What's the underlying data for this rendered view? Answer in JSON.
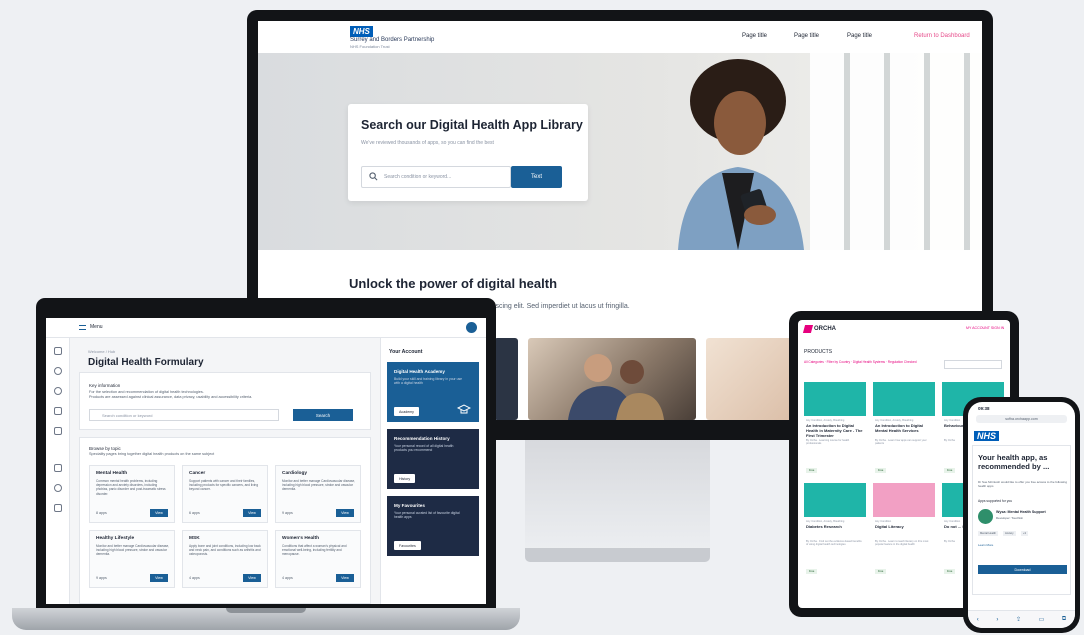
{
  "colors": {
    "nhs_blue": "#005eb8",
    "primary_button": "#1a5f96",
    "dark_card": "#1e2b45",
    "orcha_pink": "#e6007e",
    "nav_accent": "#e64a8a"
  },
  "desktop": {
    "logo_badge": "NHS",
    "org_name": "Surrey and Borders Partnership",
    "org_sub": "NHS Foundation Trust",
    "nav": [
      "Page title",
      "Page title",
      "Page title"
    ],
    "return_link": "Return to Dashboard",
    "hero": {
      "title": "Search our Digital Health App Library",
      "subtitle": "We've reviewed thousands of apps, so you can find the best",
      "search_placeholder": "Search condition or keyword...",
      "button": "Text"
    },
    "section_title": "Unlock the power of digital health",
    "section_text": "piscing elit. Sed imperdiet ut lacus ut fringilla."
  },
  "laptop": {
    "menu_label": "Menu",
    "breadcrumb": "Welcome / Hub",
    "page_title": "Digital Health Formulary",
    "info_heading": "Key information",
    "info_text_1": "For the selection and recommendation of digital health technologies.",
    "info_text_2": "Products are assessed against clinical assurance, data privacy, usability and accessibility criteria.",
    "search_placeholder": "Search condition or keyword",
    "search_button": "Search",
    "browse_heading": "Browse by topic",
    "browse_text": "Speciality pages bring together digital health products on the same subject",
    "categories": [
      {
        "title": "Mental Health",
        "desc": "Common mental health problems, including depression and anxiety disorders, including phobias, panic disorder and post-traumatic stress disorder.",
        "count": "8 apps",
        "button": "View"
      },
      {
        "title": "Cancer",
        "desc": "Support patients with cancer and their families, including products for specific cancers, and living beyond cancer.",
        "count": "6 apps",
        "button": "View"
      },
      {
        "title": "Cardiology",
        "desc": "Monitor and better manage Cardiovascular disease, including high blood pressure, stroke and vascular dementia.",
        "count": "9 apps",
        "button": "View"
      },
      {
        "title": "Healthy Lifestyle",
        "desc": "Monitor and better manage Cardiovascular disease, including high blood pressure, stroke and vascular dementia.",
        "count": "9 apps",
        "button": "View"
      },
      {
        "title": "MSK",
        "desc": "Apply bone and joint conditions, including low back and neck pain, and conditions such as arthritis and osteoporosis.",
        "count": "4 apps",
        "button": "View"
      },
      {
        "title": "Women's Health",
        "desc": "Conditions that affect a woman's physical and emotional well-being, including fertility and menopause.",
        "count": "4 apps",
        "button": "View"
      }
    ],
    "account": {
      "heading": "Your Account",
      "cards": [
        {
          "title": "Digital Health Academy",
          "desc": "Build your skill and training library in your use with a digital health",
          "button": "Academy"
        },
        {
          "title": "Recommendation History",
          "desc": "Your personal record of all digital health products you recommend",
          "button": "History"
        },
        {
          "title": "My Favourites",
          "desc": "Your personal curated list of favourite digital health apps",
          "button": "Favourites"
        }
      ]
    }
  },
  "tablet": {
    "logo": "ORCHA",
    "top_links": "MY ACCOUNT   SIGN IN",
    "products_label": "PRODUCTS",
    "filters": "All Categories · Filter by Country · Digital Health Systems · Regulation Checked",
    "cards": [
      {
        "category": "Any Condition, Anxiety, Breathing",
        "title": "An Introduction to Digital Health in Maternity Care - The First Trimester",
        "meta": "By Orcha · Learning course for health professionals",
        "tag": "Free",
        "img": "#1fb5a8"
      },
      {
        "category": "Any Condition, Anxiety, Breathing",
        "title": "An Introduction to Digital Mental Health Services",
        "meta": "By Orcha · Learn how apps can support your patients",
        "tag": "Free",
        "img": "#1fb5a8"
      },
      {
        "category": "Any Condition",
        "title": "Behaviour Change",
        "meta": "By Orcha",
        "tag": "Free",
        "img": "#1fb5a8"
      },
      {
        "category": "Any Condition, Anxiety, Breathing",
        "title": "Diabetes Research",
        "meta": "By Orcha · Find out the evidence-based benefits of using digital health technologies",
        "tag": "Free",
        "img": "#1fb5a8"
      },
      {
        "category": "Any Condition",
        "title": "Digital Literacy",
        "meta": "By Orcha · Learn to teach literacy on this most popular feature in the digital health",
        "tag": "Free",
        "img": "#f2a0c4"
      },
      {
        "category": "Any Condition",
        "title": "Do not ... Service ...",
        "meta": "By Orcha",
        "tag": "Free",
        "img": "#1fb5a8"
      }
    ]
  },
  "phone": {
    "time": "09:38",
    "url": "sofha.orchaapp.com",
    "nhs_badge": "NHS",
    "headline": "Your health app, as recommended by ...",
    "intro": "Dr Sue Mcintosh would like to offer you free access to the following health apps",
    "supported_label": "Apps supported for you",
    "app_name": "Wysa: Mental Health Support",
    "app_dev": "Developer: Touchkin",
    "chips": [
      "Mental Health",
      "Anxiety",
      "+3"
    ],
    "learn_more": "Learn More",
    "download": "Download"
  }
}
